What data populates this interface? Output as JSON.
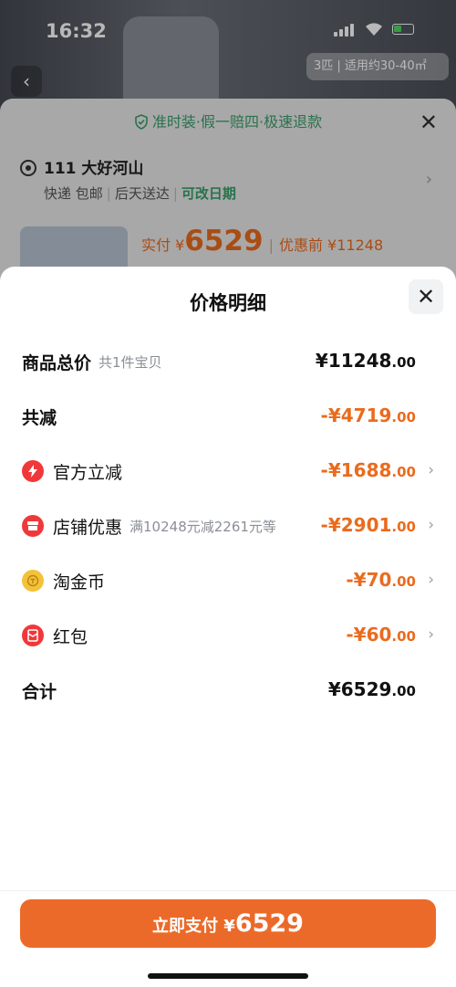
{
  "status_bar": {
    "time": "16:32"
  },
  "background": {
    "top_tag": "3匹 | 适用约30-40㎡",
    "checkout": {
      "guarantee": "准时装·假一赔四·极速退款",
      "address": "111 大好河山",
      "delivery": [
        "快递 包邮",
        "后天送达"
      ],
      "delivery_highlight": "可改日期",
      "pay_prefix": "实付 ¥",
      "pay_amount": "6529",
      "before_discount": "优惠前 ¥11248"
    }
  },
  "sheet": {
    "title": "价格明细",
    "rows": [
      {
        "label": "商品总价",
        "sub": "共1件宝贝",
        "int": "¥11248",
        "dec": ".00"
      },
      {
        "label": "共减",
        "int": "-¥4719",
        "dec": ".00"
      },
      {
        "label": "官方立减",
        "icon": "lightning-icon",
        "int": "-¥1688",
        "dec": ".00"
      },
      {
        "label": "店铺优惠",
        "icon": "store-icon",
        "sub": "满10248元减2261元等",
        "int": "-¥2901",
        "dec": ".00"
      },
      {
        "label": "淘金币",
        "icon": "coin-icon",
        "int": "-¥70",
        "dec": ".00"
      },
      {
        "label": "红包",
        "icon": "red-packet-icon",
        "int": "-¥60",
        "dec": ".00"
      },
      {
        "label": "合计",
        "int": "¥6529",
        "dec": ".00"
      }
    ]
  },
  "pay_button": {
    "label": "立即支付 ¥",
    "amount": "6529"
  },
  "colors": {
    "accent": "#ec6a29",
    "discount": "#ea6b1e",
    "guarantee": "#3a9e6a"
  }
}
